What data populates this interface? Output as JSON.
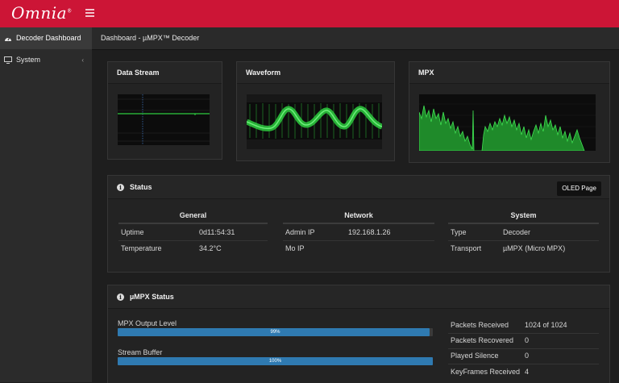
{
  "app": {
    "logo_text": "Omnia",
    "logo_mark": "®"
  },
  "sidebar": {
    "items": [
      {
        "label": "Decoder Dashboard",
        "icon": "gauge-icon",
        "active": true
      },
      {
        "label": "System",
        "icon": "monitor-icon",
        "chevron": "‹"
      }
    ]
  },
  "breadcrumb": "Dashboard - µMPX™ Decoder",
  "panels": {
    "data_stream": {
      "title": "Data Stream"
    },
    "waveform": {
      "title": "Waveform"
    },
    "mpx": {
      "title": "MPX"
    }
  },
  "status": {
    "title": "Status",
    "oled_button": "OLED Page",
    "general": {
      "title": "General",
      "rows": [
        {
          "key": "Uptime",
          "value": "0d11:54:31"
        },
        {
          "key": "Temperature",
          "value": "34.2°C"
        }
      ]
    },
    "network": {
      "title": "Network",
      "rows": [
        {
          "key": "Admin IP",
          "value": "192.168.1.26"
        },
        {
          "key": "Mo IP",
          "value": ""
        }
      ]
    },
    "system": {
      "title": "System",
      "rows": [
        {
          "key": "Type",
          "value": "Decoder"
        },
        {
          "key": "Transport",
          "value": "µMPX (Micro MPX)"
        }
      ]
    }
  },
  "umpx_status": {
    "title": "µMPX Status",
    "bars": [
      {
        "label": "MPX Output Level",
        "percent": 99,
        "text": "99%"
      },
      {
        "label": "Stream Buffer",
        "percent": 100,
        "text": "100%"
      }
    ],
    "stats": [
      {
        "key": "Packets Received",
        "value": "1024 of 1024"
      },
      {
        "key": "Packets Recovered",
        "value": "0"
      },
      {
        "key": "Played Silence",
        "value": "0"
      },
      {
        "key": "KeyFrames Received",
        "value": "4"
      }
    ]
  },
  "colors": {
    "brand_red": "#cc1536",
    "scope_green": "#2ecc40",
    "bar_blue": "#2f7ab1"
  }
}
